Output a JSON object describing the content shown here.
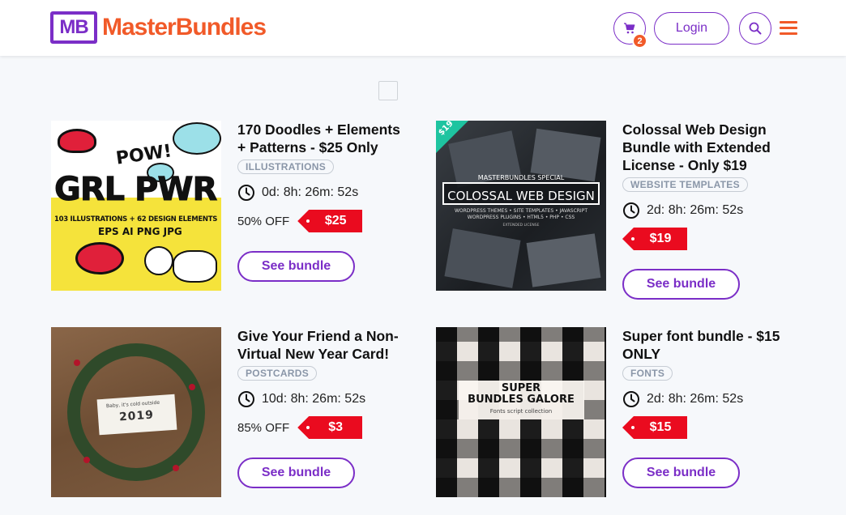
{
  "brand": {
    "mark": "MB",
    "name": "MasterBundles"
  },
  "header": {
    "cart_count": "2",
    "login_label": "Login"
  },
  "bundles": [
    {
      "title": "170 Doodles + Elements + Patterns - $25 Only",
      "tag": "ILLUSTRATIONS",
      "timer": "0d: 8h: 26m: 52s",
      "discount": "50% OFF",
      "price": "$25",
      "button": "See bundle",
      "image_text": {
        "line1": "GRL PWR",
        "line2": "103 ILLUSTRATIONS + 62 DESIGN ELEMENTS",
        "line3": "EPS  AI  PNG  JPG",
        "pow": "POW!"
      }
    },
    {
      "title": "Colossal Web Design Bundle with Extended License - Only $19",
      "tag": "WEBSITE TEMPLATES",
      "timer": "2d: 8h: 26m: 52s",
      "discount": "",
      "price": "$19",
      "button": "See bundle",
      "image_text": {
        "corner": "$19",
        "line1": "MASTERBUNDLES SPECIAL",
        "line2": "COLOSSAL WEB DESIGN",
        "line3": "WORDPRESS THEMES • SITE TEMPLATES • JAVASCRIPT",
        "line4": "WORDPRESS PLUGINS • HTML5 • PHP • CSS",
        "line5": "EXTENDED LICENSE"
      }
    },
    {
      "title": "Give Your Friend a Non-Virtual New Year Card!",
      "tag": "POSTCARDS",
      "timer": "10d: 8h: 26m: 52s",
      "discount": "85% OFF",
      "price": "$3",
      "button": "See bundle",
      "image_text": {
        "line1": "Baby, it's cold outside",
        "line2": "2019"
      }
    },
    {
      "title": "Super font bundle - $15 ONLY",
      "tag": "FONTS",
      "timer": "2d: 8h: 26m: 52s",
      "discount": "",
      "price": "$15",
      "button": "See bundle",
      "image_text": {
        "line1": "SUPER",
        "line2": "BUNDLES GALORE",
        "line3": "Fonts script collection"
      }
    }
  ],
  "colors": {
    "brand_purple": "#7b2ec7",
    "brand_orange": "#f15a29",
    "price_red": "#ea0b1f"
  },
  "icons": [
    "cart-icon",
    "search-icon",
    "menu-icon",
    "clock-icon"
  ]
}
